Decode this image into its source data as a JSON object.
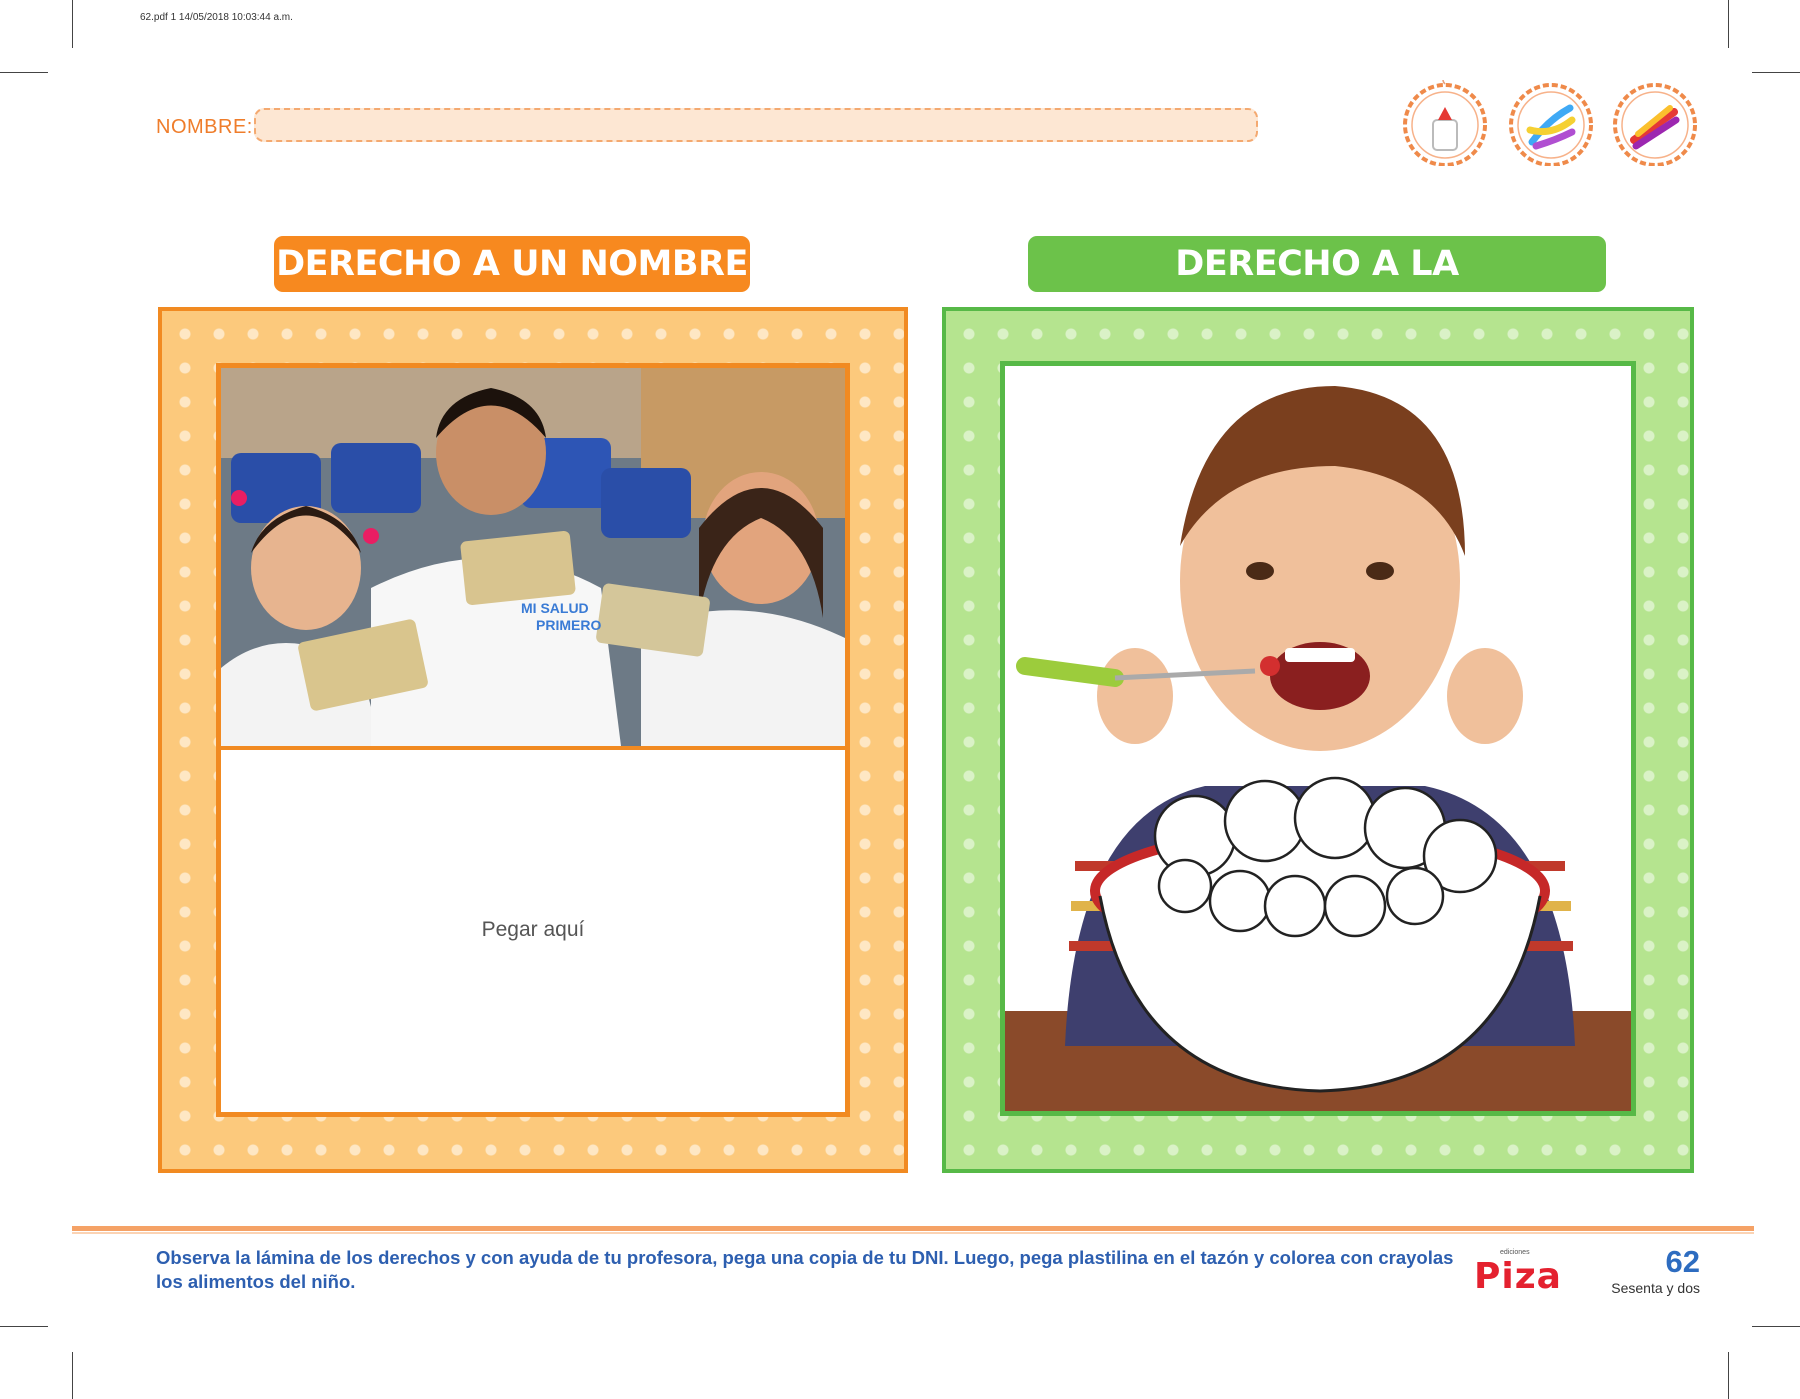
{
  "print_header": "62.pdf   1   14/05/2018   10:03:44 a.m.",
  "name_label": "NOMBRE:",
  "activity_icons": [
    "glue-bottle-icon",
    "plasticine-icon",
    "crayons-icon"
  ],
  "sections": [
    {
      "title": "DERECHO A UN NOMBRE",
      "color": "#f7891f",
      "photo": "children-holding-dni-cards",
      "photo_texts": [
        "MI SALUD",
        "PRIMERO"
      ],
      "paste_label": "Pegar aquí"
    },
    {
      "title": "DERECHO A LA ALIMENTACIÓN",
      "color": "#6cc24a",
      "photo": "boy-eating-from-bowl"
    }
  ],
  "instructions": "Observa la lámina de los derechos y con ayuda de tu profesora, pega una copia de tu DNI. Luego, pega plastilina en el tazón y colorea con crayolas los alimentos del niño.",
  "brand": {
    "small": "ediciones",
    "name": "Piza"
  },
  "page": {
    "number": "62",
    "words": "Sesenta y dos"
  }
}
